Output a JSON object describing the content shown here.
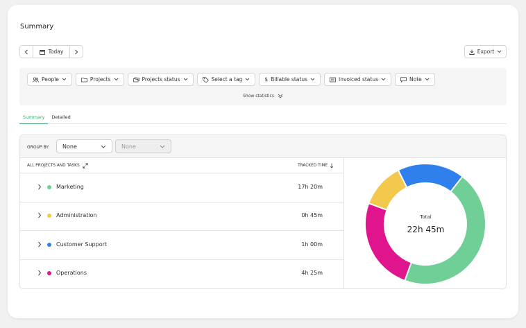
{
  "page": {
    "title": "Summary"
  },
  "date_nav": {
    "label": "Today"
  },
  "export": {
    "label": "Export"
  },
  "filters": [
    {
      "label": "People",
      "icon": "people-icon"
    },
    {
      "label": "Projects",
      "icon": "folder-icon"
    },
    {
      "label": "Projects status",
      "icon": "folders-icon"
    },
    {
      "label": "Select a tag",
      "icon": "tag-icon"
    },
    {
      "label": "Billable status",
      "icon": "dollar-icon"
    },
    {
      "label": "Invoiced status",
      "icon": "invoice-icon"
    },
    {
      "label": "Note",
      "icon": "note-icon"
    }
  ],
  "show_statistics": "Show statistics",
  "tabs": [
    {
      "label": "Summary",
      "active": true
    },
    {
      "label": "Detailed",
      "active": false
    }
  ],
  "group_by": {
    "label": "GROUP BY:",
    "primary": "None",
    "secondary": "None"
  },
  "table": {
    "header_left": "ALL PROJECTS AND TASKS",
    "header_right": "TRACKED TIME"
  },
  "rows": [
    {
      "name": "Marketing",
      "time": "17h 20m",
      "color": "#6fcf97"
    },
    {
      "name": "Administration",
      "time": "0h 45m",
      "color": "#f2c94c"
    },
    {
      "name": "Customer Support",
      "time": "1h 00m",
      "color": "#2f80ed"
    },
    {
      "name": "Operations",
      "time": "4h 25m",
      "color": "#e0148c"
    }
  ],
  "donut": {
    "label": "Total",
    "value": "22h 45m"
  },
  "chart_data": {
    "type": "pie",
    "categories": [
      "Marketing",
      "Operations",
      "Administration",
      "Customer Support"
    ],
    "values": [
      45,
      25,
      12,
      18
    ],
    "colors": [
      "#6fcf97",
      "#e0148c",
      "#f2c94c",
      "#2f80ed"
    ]
  }
}
